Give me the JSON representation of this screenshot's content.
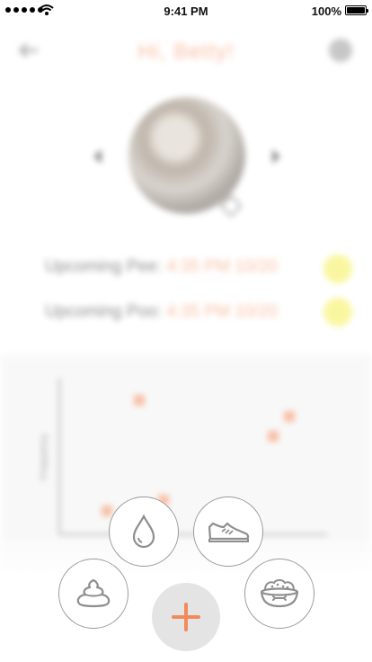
{
  "status_bar": {
    "time": "9:41 PM",
    "battery": "100%",
    "icons": [
      "signal-dots-icon",
      "wifi-icon",
      "battery-icon"
    ]
  },
  "header": {
    "title": "Hi, Betty!",
    "back_icon": "back-arrow-icon",
    "settings_icon": "gear-icon"
  },
  "upcoming": [
    {
      "label": "Upcoming Pee:",
      "value": "4:35 PM 10/20"
    },
    {
      "label": "Upcoming Poo:",
      "value": "4:35 PM 10/20"
    }
  ],
  "chart_data": {
    "type": "scatter",
    "ylabel": "Frequency",
    "series": [
      {
        "values": []
      }
    ]
  },
  "actions": [
    {
      "name": "water",
      "icon": "water-drop-icon"
    },
    {
      "name": "walk",
      "icon": "shoe-icon"
    },
    {
      "name": "poop",
      "icon": "poop-icon"
    },
    {
      "name": "food",
      "icon": "food-bowl-icon"
    }
  ],
  "add_button": {
    "icon": "plus-icon"
  },
  "colors": {
    "accent": "#f28a5c",
    "badge": "#f6f052",
    "border": "#9a9a9a",
    "add_bg": "#e4e4e4"
  }
}
